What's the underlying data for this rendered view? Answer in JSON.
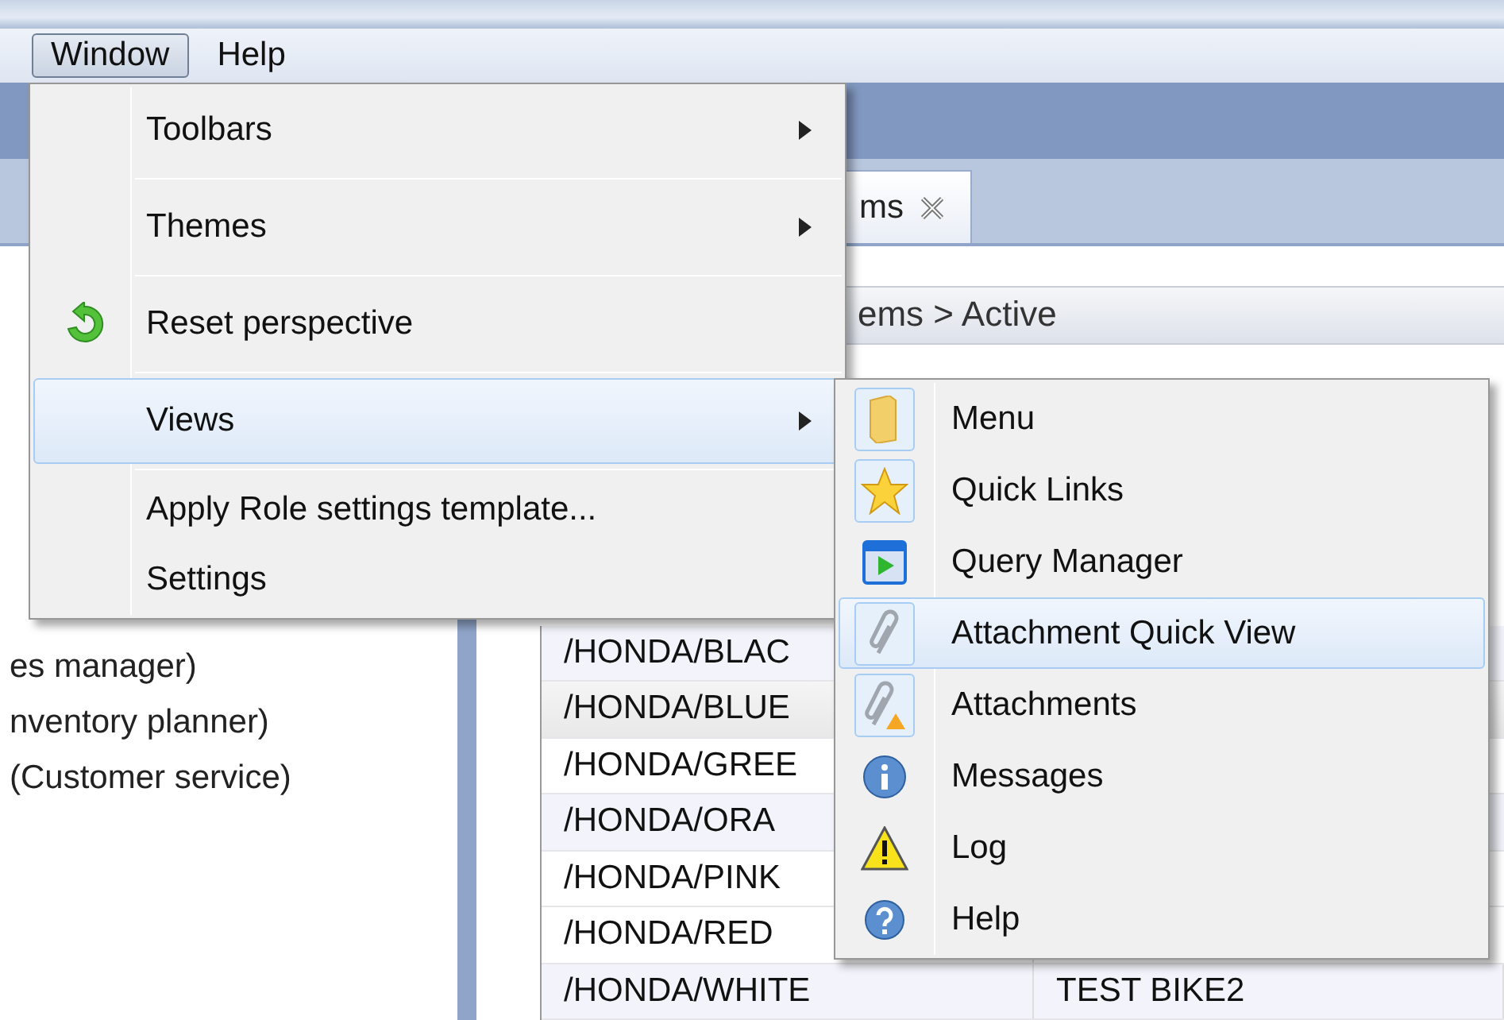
{
  "menu_bar": [
    {
      "label": "Window",
      "selected": true
    },
    {
      "label": "Help",
      "selected": false
    }
  ],
  "left_panel": {
    "lines": [
      "es manager)",
      "nventory planner)",
      "(Customer service)"
    ]
  },
  "editor_tab": {
    "label": "ms"
  },
  "breadcrumb": "ems > Active",
  "table": {
    "rows": [
      {
        "cells": [
          "/HONDA/BLAC"
        ],
        "selected": false
      },
      {
        "cells": [
          "/HONDA/BLUE"
        ],
        "selected": true
      },
      {
        "cells": [
          "/HONDA/GREE"
        ],
        "selected": false
      },
      {
        "cells": [
          "/HONDA/ORA"
        ],
        "selected": false
      },
      {
        "cells": [
          "/HONDA/PINK"
        ],
        "selected": false
      },
      {
        "cells": [
          "/HONDA/RED"
        ],
        "selected": false
      },
      {
        "cells": [
          "/HONDA/WHITE",
          "TEST BIKE2"
        ],
        "selected": false
      }
    ]
  },
  "window_menu": {
    "items": [
      {
        "label": "Toolbars",
        "has_submenu": true,
        "highlighted": false,
        "separator_after": true
      },
      {
        "label": "Themes",
        "has_submenu": true,
        "highlighted": false,
        "separator_after": true
      },
      {
        "label": "Reset perspective",
        "has_submenu": false,
        "highlighted": false,
        "separator_after": true
      },
      {
        "label": "Views",
        "has_submenu": true,
        "highlighted": true,
        "separator_after": true
      },
      {
        "label": "Apply Role settings template...",
        "has_submenu": false,
        "highlighted": false,
        "separator_after": false
      },
      {
        "label": "Settings",
        "has_submenu": false,
        "highlighted": false,
        "separator_after": false
      }
    ]
  },
  "views_submenu": {
    "items": [
      {
        "label": "Menu",
        "checked": true,
        "highlighted": false
      },
      {
        "label": "Quick Links",
        "checked": true,
        "highlighted": false
      },
      {
        "label": "Query Manager",
        "checked": false,
        "highlighted": false
      },
      {
        "label": "Attachment Quick View",
        "checked": true,
        "highlighted": true
      },
      {
        "label": "Attachments",
        "checked": true,
        "highlighted": false
      },
      {
        "label": "Messages",
        "checked": false,
        "highlighted": false
      },
      {
        "label": "Log",
        "checked": false,
        "highlighted": false
      },
      {
        "label": "Help",
        "checked": false,
        "highlighted": false
      }
    ]
  }
}
